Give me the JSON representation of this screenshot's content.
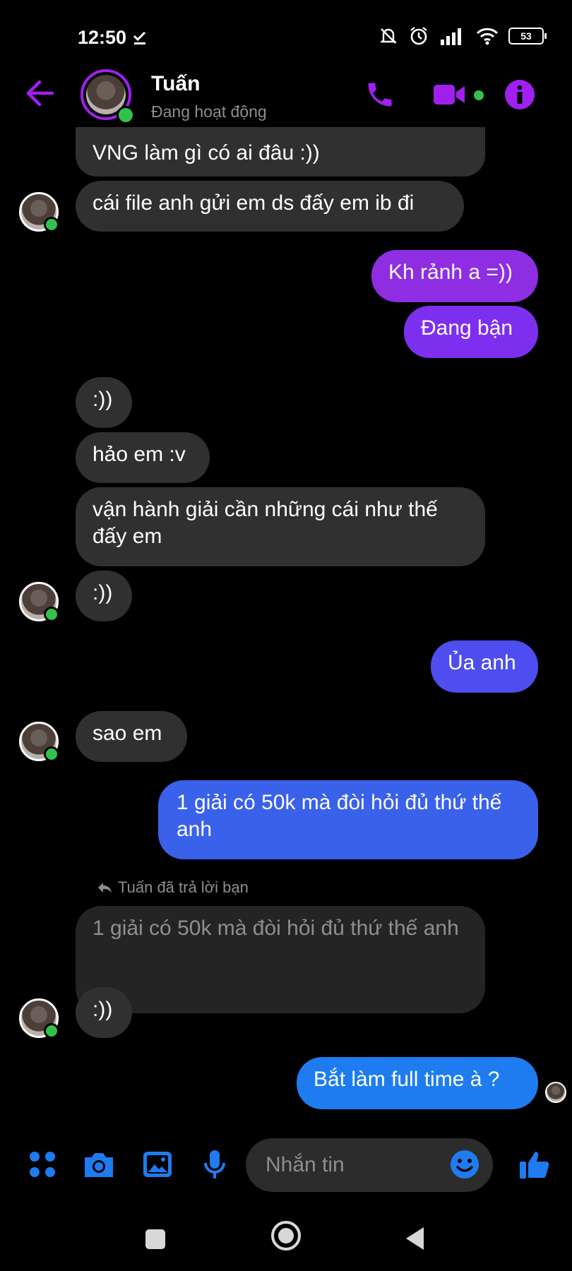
{
  "status_bar": {
    "time": "12:50",
    "battery": "53"
  },
  "header": {
    "name": "Tuấn",
    "status": "Đang hoạt động"
  },
  "colors": {
    "accent": "#a020f0",
    "online": "#31c24d",
    "incoming": "#303030",
    "purple": "#8e2de2",
    "indigo": "#4d4df0",
    "blue": "#3a61ea",
    "sky": "#1e7cf0"
  },
  "messages": [
    {
      "dir": "in",
      "text": "VNG làm gì có ai đâu :))"
    },
    {
      "dir": "in",
      "text": "cái file anh gửi em ds đấy em ib đi"
    },
    {
      "dir": "out",
      "text": "Kh rảnh a =))"
    },
    {
      "dir": "out",
      "text": "Đang bận"
    },
    {
      "dir": "in",
      "text": ":))"
    },
    {
      "dir": "in",
      "text": "hảo em :v"
    },
    {
      "dir": "in",
      "text": "vận hành giải cần những cái như thế đấy em"
    },
    {
      "dir": "in",
      "text": ":))"
    },
    {
      "dir": "out",
      "text": "Ủa anh"
    },
    {
      "dir": "in",
      "text": "sao em"
    },
    {
      "dir": "out",
      "text": "1 giải có 50k mà đòi hỏi đủ thứ thế anh"
    },
    {
      "dir": "in",
      "reply_note": "Tuấn đã trả lời bạn",
      "quoted": "1 giải có 50k mà đòi hỏi đủ thứ thế anh",
      "text": ":))"
    },
    {
      "dir": "out",
      "text": "Bắt làm full time à ?"
    }
  ],
  "composer": {
    "placeholder": "Nhắn tin"
  }
}
